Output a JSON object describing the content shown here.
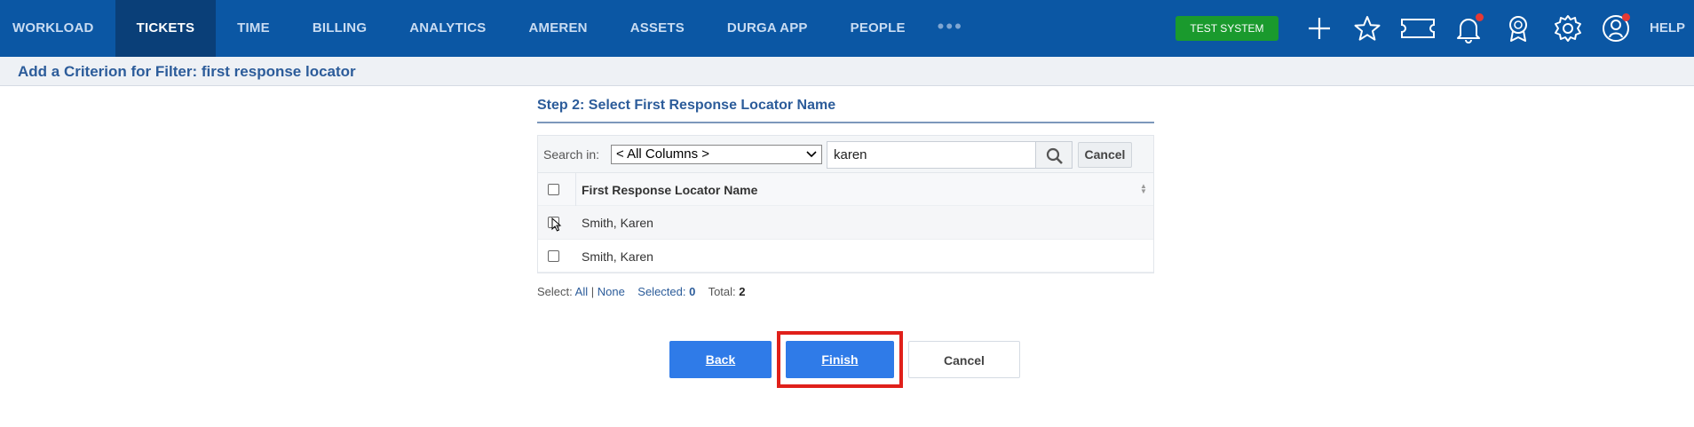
{
  "nav": {
    "items": [
      {
        "label": "WORKLOAD",
        "active": false
      },
      {
        "label": "TICKETS",
        "active": true
      },
      {
        "label": "TIME",
        "active": false
      },
      {
        "label": "BILLING",
        "active": false
      },
      {
        "label": "ANALYTICS",
        "active": false
      },
      {
        "label": "AMEREN",
        "active": false
      },
      {
        "label": "ASSETS",
        "active": false
      },
      {
        "label": "DURGA APP",
        "active": false
      },
      {
        "label": "PEOPLE",
        "active": false
      }
    ],
    "more_label": "•••",
    "test_badge": "TEST SYSTEM",
    "help_label": "HELP",
    "icons": [
      "plus-icon",
      "star-icon",
      "ticket-icon",
      "bell-icon",
      "award-icon",
      "gear-icon",
      "user-icon"
    ],
    "accent": "#0b57a4",
    "active_bg": "#0a3f78",
    "badge_color": "#1a9a2d",
    "notification_color": "#e53935"
  },
  "subheader": {
    "title": "Add a Criterion for Filter: first response locator"
  },
  "step": {
    "title": "Step 2: Select First Response Locator Name"
  },
  "search": {
    "label": "Search in:",
    "column_selected": "< All Columns >",
    "query": "karen",
    "cancel_label": "Cancel"
  },
  "table": {
    "column_header": "First Response Locator Name",
    "rows": [
      {
        "name": "Smith, Karen",
        "checked": false
      },
      {
        "name": "Smith, Karen",
        "checked": false
      }
    ]
  },
  "selection": {
    "prefix": "Select:",
    "all_label": "All",
    "separator": "|",
    "none_label": "None",
    "selected_label": "Selected:",
    "selected_count": "0",
    "total_label": "Total:",
    "total_count": "2"
  },
  "buttons": {
    "back": "Back",
    "finish": "Finish",
    "cancel": "Cancel",
    "primary_color": "#2f7be8",
    "highlight_color": "#e0201a"
  }
}
